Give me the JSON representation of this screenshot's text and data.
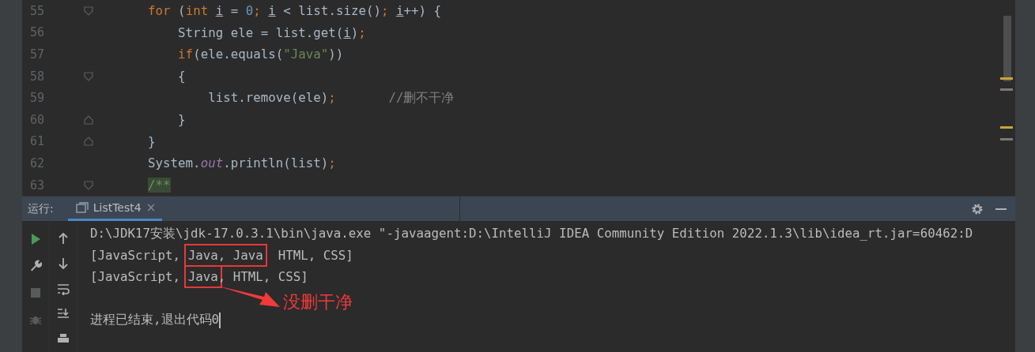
{
  "editor": {
    "lines": [
      {
        "number": "55",
        "fold_start": true,
        "tokens": [
          {
            "t": "    for",
            "kind": "keyword"
          },
          {
            "t": " (",
            "kind": "plain"
          },
          {
            "t": "int ",
            "kind": "keyword"
          },
          {
            "t": "i",
            "kind": "var"
          },
          {
            "t": " = ",
            "kind": "plain"
          },
          {
            "t": "0",
            "kind": "number"
          },
          {
            "t": "; ",
            "kind": "keyword"
          },
          {
            "t": "i",
            "kind": "var"
          },
          {
            "t": " < list.size()",
            "kind": "plain"
          },
          {
            "t": "; ",
            "kind": "keyword"
          },
          {
            "t": "i",
            "kind": "var"
          },
          {
            "t": "++) {",
            "kind": "plain"
          }
        ]
      },
      {
        "number": "56",
        "tokens": [
          {
            "t": "        String ele = list.get(",
            "kind": "plain"
          },
          {
            "t": "i",
            "kind": "var"
          },
          {
            "t": ")",
            "kind": "plain"
          },
          {
            "t": ";",
            "kind": "keyword"
          }
        ]
      },
      {
        "number": "57",
        "tokens": [
          {
            "t": "        if",
            "kind": "keyword"
          },
          {
            "t": "(ele.equals(",
            "kind": "plain"
          },
          {
            "t": "\"Java\"",
            "kind": "string"
          },
          {
            "t": "))",
            "kind": "plain"
          }
        ]
      },
      {
        "number": "58",
        "fold_start": true,
        "tokens": [
          {
            "t": "        {",
            "kind": "plain"
          }
        ]
      },
      {
        "number": "59",
        "tokens": [
          {
            "t": "            list.remove(ele)",
            "kind": "plain"
          },
          {
            "t": ";",
            "kind": "keyword"
          },
          {
            "t": "       //删不干净",
            "kind": "comment"
          }
        ]
      },
      {
        "number": "60",
        "fold_end": true,
        "tokens": [
          {
            "t": "        }",
            "kind": "plain"
          }
        ]
      },
      {
        "number": "61",
        "fold_end": true,
        "tokens": [
          {
            "t": "    }",
            "kind": "plain"
          }
        ]
      },
      {
        "number": "62",
        "tokens": [
          {
            "t": "    System.",
            "kind": "plain"
          },
          {
            "t": "out",
            "kind": "field"
          },
          {
            "t": ".println(list)",
            "kind": "plain"
          },
          {
            "t": ";",
            "kind": "keyword"
          }
        ]
      },
      {
        "number": "63",
        "fold_start": true,
        "tokens": [
          {
            "t": "    /**",
            "kind": "doc"
          }
        ]
      }
    ]
  },
  "run_panel": {
    "label": "运行:",
    "tabs": [
      {
        "title": "ListTest4",
        "close": "×",
        "selected": true
      }
    ],
    "tools_left": [
      {
        "kind": "run",
        "disabled": false
      },
      {
        "kind": "wrench",
        "disabled": false
      },
      {
        "kind": "stop",
        "disabled": true
      },
      {
        "kind": "bug",
        "disabled": true
      }
    ],
    "tools_right": [
      {
        "kind": "up"
      },
      {
        "kind": "down"
      },
      {
        "kind": "wrap"
      },
      {
        "kind": "scroll-end"
      },
      {
        "kind": "print"
      }
    ],
    "console": [
      {
        "kind": "command",
        "parts": [
          {
            "text": "D:\\JDK17安装\\jdk-17.0.3.1\\bin\\java.exe \"-javaagent:D:\\IntelliJ IDEA Community Edition 2022.1.3\\lib\\idea_rt.jar=60462:D"
          }
        ]
      },
      {
        "kind": "output",
        "parts": [
          {
            "text": "[JavaScript, ",
            "boxed": false
          },
          {
            "text": "Java, Java",
            "boxed": true
          },
          {
            "text": "  HTML, CSS]",
            "boxed": false
          }
        ]
      },
      {
        "kind": "output",
        "parts": [
          {
            "text": "[JavaScript, ",
            "boxed": false
          },
          {
            "text": "Java",
            "boxed": true
          },
          {
            "text": ", HTML, CSS]",
            "boxed": false
          }
        ]
      },
      {
        "kind": "exit",
        "parts": [
          {
            "text": "进程已结束,退出代码0"
          }
        ]
      }
    ],
    "annotation": "没删干净"
  }
}
